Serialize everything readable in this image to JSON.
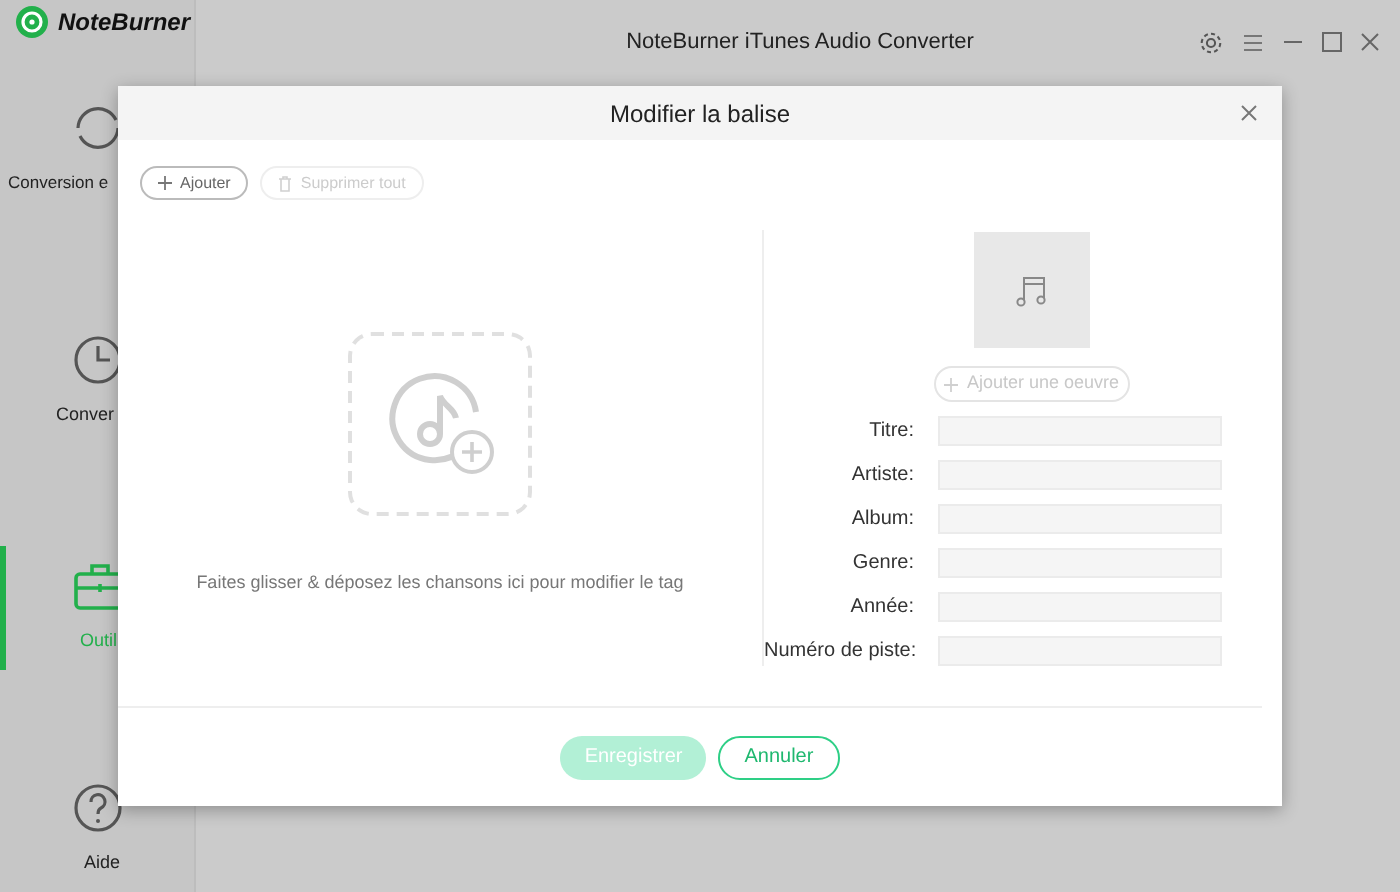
{
  "app": {
    "logo": "NoteBurner",
    "title": "NoteBurner iTunes Audio Converter"
  },
  "sidebar": {
    "items": [
      {
        "label": "Conversion e",
        "selected": false
      },
      {
        "label": "Conver",
        "selected": false
      },
      {
        "label": "Outil",
        "selected": true
      },
      {
        "label": "Aide",
        "selected": false
      }
    ]
  },
  "dialog": {
    "title": "Modifier la balise",
    "toolbar": [
      {
        "label": "Ajouter",
        "disabled": false
      },
      {
        "label": "Supprimer tout",
        "disabled": true
      }
    ],
    "drop_hint": "Faites glisser & déposez les chansons ici pour modifier le tag",
    "artwork_button": {
      "label": "Ajouter une oeuvre",
      "disabled": true
    },
    "fields": [
      {
        "label": "Titre:"
      },
      {
        "label": "Artiste:"
      },
      {
        "label": "Album:"
      },
      {
        "label": "Genre:"
      },
      {
        "label": "Année:"
      },
      {
        "label": "Numéro de piste:"
      }
    ],
    "buttons": [
      {
        "label": "Enregistrer",
        "kind": "primary",
        "disabled": true
      },
      {
        "label": "Annuler",
        "kind": "secondary",
        "disabled": false
      }
    ]
  }
}
